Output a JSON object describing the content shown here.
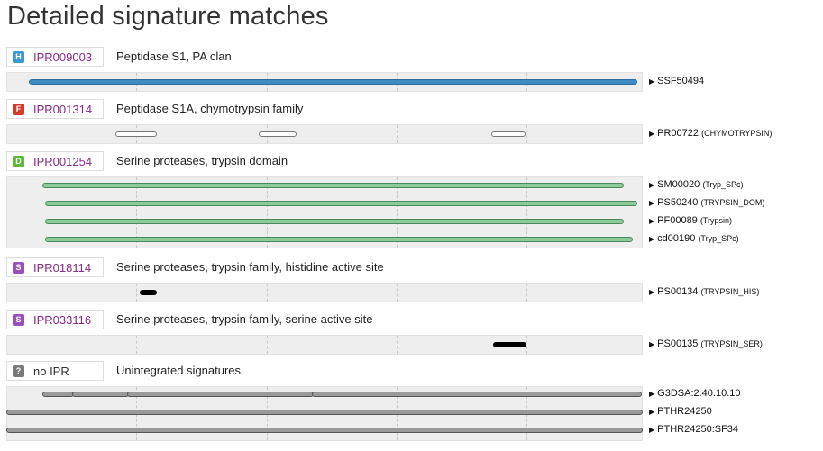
{
  "page": {
    "title": "Detailed signature matches"
  },
  "colors": {
    "homologous": "#3d97d4",
    "family": "#d63a2a",
    "domain": "#5fb83a",
    "site": "#9b4fba",
    "unintegrated": "#7a7a7a",
    "bar_blue": "#3e8ac3",
    "bar_green": "#8dca9a",
    "bar_gray": "#9a9a9a"
  },
  "sections": [
    {
      "badge": "H",
      "badge_color": "#3d97d4",
      "accession": "IPR009003",
      "name": "Peptidase S1, PA clan",
      "signatures": [
        {
          "id": "SSF50494",
          "sub": ""
        }
      ]
    },
    {
      "badge": "F",
      "badge_color": "#d63a2a",
      "accession": "IPR001314",
      "name": "Peptidase S1A, chymotrypsin family",
      "signatures": [
        {
          "id": "PR00722",
          "sub": "(CHYMOTRYPSIN)"
        }
      ]
    },
    {
      "badge": "D",
      "badge_color": "#5fb83a",
      "accession": "IPR001254",
      "name": "Serine proteases, trypsin domain",
      "signatures": [
        {
          "id": "SM00020",
          "sub": "(Tryp_SPc)"
        },
        {
          "id": "PS50240",
          "sub": "(TRYPSIN_DOM)"
        },
        {
          "id": "PF00089",
          "sub": "(Trypsin)"
        },
        {
          "id": "cd00190",
          "sub": "(Tryp_SPc)"
        }
      ]
    },
    {
      "badge": "S",
      "badge_color": "#9b4fba",
      "accession": "IPR018114",
      "name": "Serine proteases, trypsin family, histidine active site",
      "signatures": [
        {
          "id": "PS00134",
          "sub": "(TRYPSIN_HIS)"
        }
      ]
    },
    {
      "badge": "S",
      "badge_color": "#9b4fba",
      "accession": "IPR033116",
      "name": "Serine proteases, trypsin family, serine active site",
      "signatures": [
        {
          "id": "PS00135",
          "sub": "(TRYPSIN_SER)"
        }
      ]
    },
    {
      "badge": "?",
      "badge_color": "#7a7a7a",
      "accession": "no IPR",
      "name": "Unintegrated signatures",
      "signatures": [
        {
          "id": "G3DSA:2.40.10.10",
          "sub": ""
        },
        {
          "id": "PTHR24250",
          "sub": ""
        },
        {
          "id": "PTHR24250:SF34",
          "sub": ""
        }
      ]
    }
  ]
}
